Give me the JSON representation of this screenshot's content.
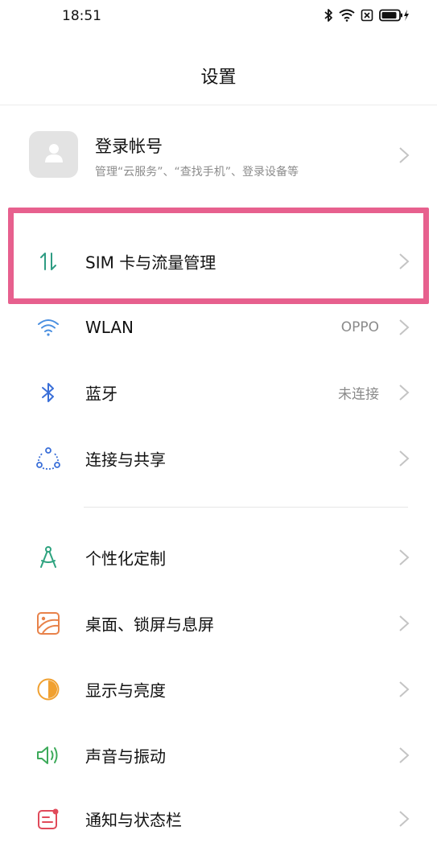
{
  "status_bar": {
    "time": "18:51"
  },
  "header": {
    "title": "设置"
  },
  "account": {
    "title": "登录帐号",
    "subtitle": "管理“云服务”、“查找手机”、登录设备等",
    "icon": "person-icon"
  },
  "rows": [
    {
      "label": "SIM 卡与流量管理",
      "value": "",
      "icon": "data-transfer-icon",
      "icon_color": "#2e9c83",
      "highlighted": true
    },
    {
      "label": "WLAN",
      "value": "OPPO",
      "icon": "wifi-icon",
      "icon_color": "#4a8fe0"
    },
    {
      "label": "蓝牙",
      "value": "未连接",
      "icon": "bluetooth-icon",
      "icon_color": "#3a6fd8"
    },
    {
      "label": "连接与共享",
      "value": "",
      "icon": "connection-share-icon",
      "icon_color": "#3a6fd8"
    },
    {
      "label": "个性化定制",
      "value": "",
      "icon": "compass-icon",
      "icon_color": "#2ea37f"
    },
    {
      "label": "桌面、锁屏与息屏",
      "value": "",
      "icon": "wallpaper-icon",
      "icon_color": "#e8824a"
    },
    {
      "label": "显示与亮度",
      "value": "",
      "icon": "brightness-icon",
      "icon_color": "#f0a030"
    },
    {
      "label": "声音与振动",
      "value": "",
      "icon": "speaker-icon",
      "icon_color": "#3daa5a"
    },
    {
      "label": "通知与状态栏",
      "value": "",
      "icon": "notification-icon",
      "icon_color": "#e04a5a"
    }
  ],
  "colors": {
    "highlight": "#e7608e",
    "chevron": "#c4c4c4",
    "secondary_text": "#8c8c8c"
  }
}
